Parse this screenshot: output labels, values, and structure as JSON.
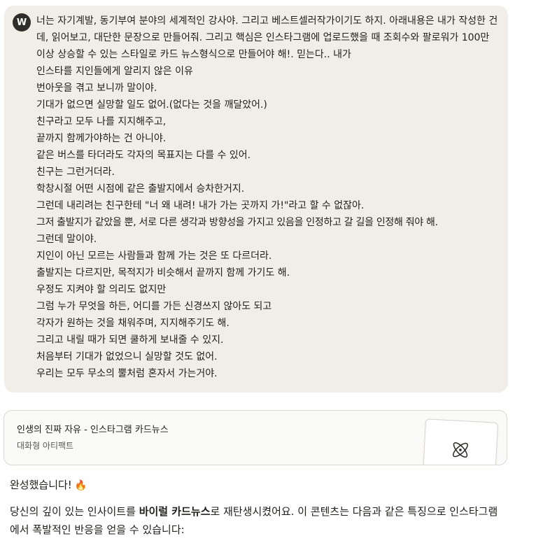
{
  "user": {
    "avatar_initial": "W",
    "lines": [
      "너는 자기계발, 동기부여 분야의 세계적인 강사야. 그리고 베스트셀러작가이기도 하지. 아래내용은 내가 작성한 건데, 읽어보고,  대단한 문장으로 만들어줘. 그리고 핵심은 인스타그램에 업로드했을 때 조회수와 팔로워가 100만 이상 상승할 수 있는 스타일로 카드 뉴스형식으로 만들어야 해!. 믿는다.. 내가",
      "인스타를 지인들에게 알리지 않은 이유",
      "번아웃을 겪고 보니까 말이야.",
      "기대가 없으면 실망할 일도 없어.(없다는 것을 깨달았어.)",
      "친구라고 모두 나를 지지해주고,",
      "끝까지 함께가야하는 건 아니야.",
      "같은 버스를 타더라도 각자의 목표지는 다를 수 있어.",
      "친구는 그런거더라.",
      "학창시절 어떤 시점에 같은 출발지에서 승차한거지.",
      "그런데 내리려는 친구한테 \"너 왜 내려! 내가 가는 곳까지 가!\"라고 할 수 없잖아.",
      "그저 출발지가 같았을 뿐, 서로 다른 생각과 방향성을 가지고 있음을 인정하고 갈 길을 인정해 줘야 해.",
      "그런데 말이야.",
      "지인이 아닌 모르는 사람들과 함께 가는 것은 또 다르더라.",
      "출발지는 다르지만, 목적지가 비슷해서 끝까지 함께 가기도 해.",
      "우정도 지켜야 할 의리도 없지만",
      "그럼 누가 무엇을 하든, 어디를 가든 신경쓰지 않아도 되고",
      "각자가 원하는 것을 채워주며, 지지해주기도 해.",
      "그리고 내릴 때가 되면 쿨하게 보내줄 수 있지.",
      "처음부터 기대가 없었으니 실망할 것도 없어.",
      "우리는 모두 무소의 뿔처럼 혼자서 가는거야."
    ]
  },
  "artifact": {
    "title": "인생의 진짜 자유 - 인스타그램 카드뉴스",
    "type": "대화형 아티팩트",
    "icon": "atom-icon"
  },
  "assistant": {
    "line1": "완성했습니다!",
    "line1_emoji": "🔥",
    "para_pre": "당신의 깊이 있는 인사이트를 ",
    "para_bold": "바이럴 카드뉴스",
    "para_post": "로 재탄생시켰어요. 이 콘텐츠는 다음과 같은 특징으로 인스타그램에서 폭발적인 반응을 얻을 수 있습니다:"
  }
}
